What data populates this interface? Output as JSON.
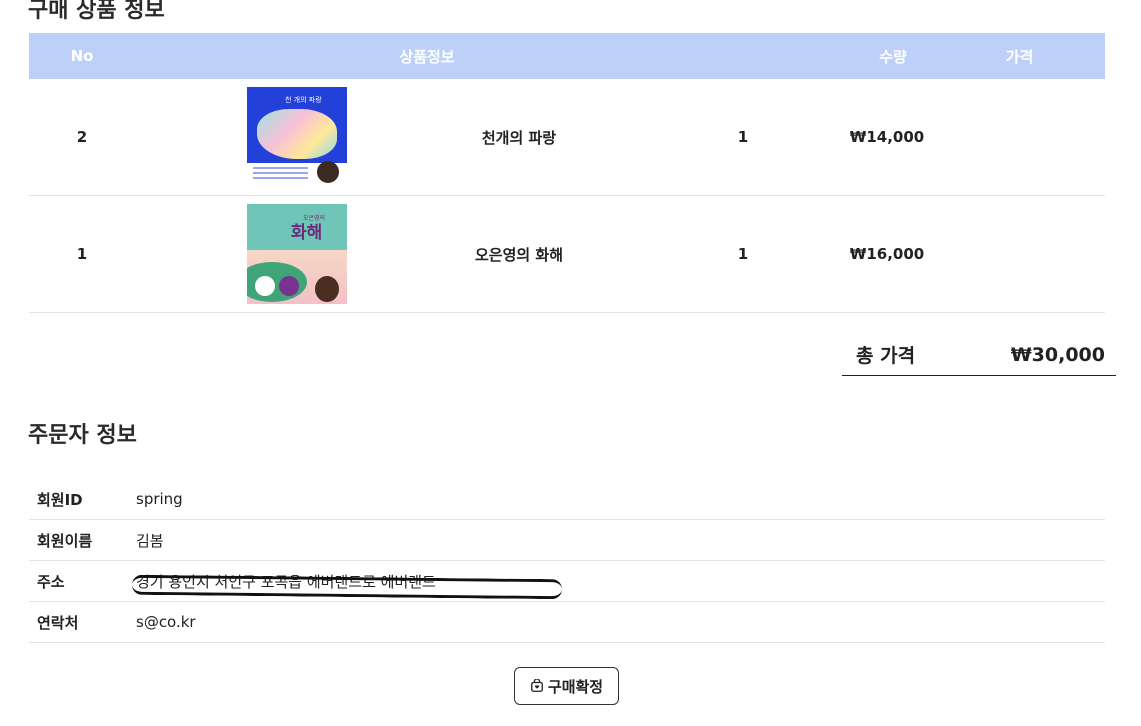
{
  "products_section": {
    "title": "구매 상품 정보",
    "headers": {
      "no": "No",
      "info": "상품정보",
      "qty": "수량",
      "price": "가격"
    },
    "rows": [
      {
        "no": "2",
        "name": "천개의 파랑",
        "qty": "1",
        "price": "₩14,000",
        "cover_title": "천 개의 파랑"
      },
      {
        "no": "1",
        "name": "오은영의 화해",
        "qty": "1",
        "price": "₩16,000",
        "cover_title": "화해",
        "cover_subtitle": "오은영의"
      }
    ],
    "total_label": "총 가격",
    "total_value": "₩30,000"
  },
  "orderer_section": {
    "title": "주문자 정보",
    "rows": [
      {
        "label": "회원ID",
        "value": "spring"
      },
      {
        "label": "회원이름",
        "value": "김봄"
      },
      {
        "label": "주소",
        "value": "경기 용인시 처인구 포곡읍 에버랜드로 에버랜드"
      },
      {
        "label": "연락처",
        "value": "s@co.kr"
      }
    ]
  },
  "confirm_button": {
    "label": "구매확정",
    "icon": "shopping-bag-icon"
  },
  "colors": {
    "header_bg": "#bdd0f7",
    "header_text": "#ffffff"
  }
}
